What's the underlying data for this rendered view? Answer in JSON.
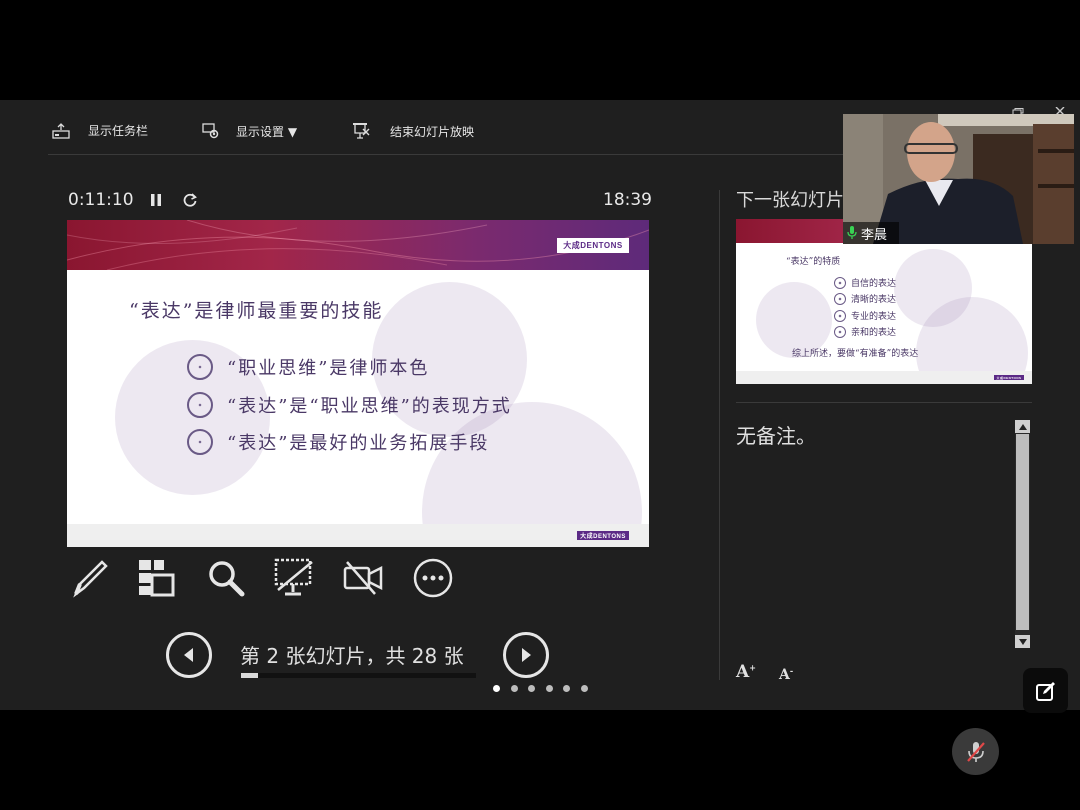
{
  "toolbar": {
    "show_taskbar": "显示任务栏",
    "display_settings": "显示设置 ▼",
    "end_slideshow": "结束幻灯片放映"
  },
  "status": {
    "elapsed_time": "0:11:10",
    "clock": "18:39"
  },
  "current_slide": {
    "logo": "大成DENTONS",
    "title": "“表达”是律师最重要的技能",
    "bullets": [
      "“职业思维”是律师本色",
      "“表达”是“职业思维”的表现方式",
      "“表达”是最好的业务拓展手段"
    ],
    "footer_logo": "大成DENTONS"
  },
  "navigation": {
    "slide_counter": "第 2 张幻灯片，共 28 张",
    "current": 2,
    "total": 28
  },
  "next_slide": {
    "label": "下一张幻灯片",
    "title": "“表达”的特质",
    "bullets": [
      "自信的表达",
      "清晰的表达",
      "专业的表达",
      "亲和的表达"
    ],
    "summary": "综上所述，要做“有准备”的表达",
    "footer_logo": "大成DENTONS"
  },
  "notes": {
    "text": "无备注。"
  },
  "video": {
    "participant_name": "李晨"
  },
  "colors": {
    "window_bg": "#1f1f1f",
    "slide_text": "#4a3866",
    "brand_purple": "#5b2a86",
    "banner_red": "#a22649"
  },
  "icons": [
    "taskbar-icon",
    "display-settings-icon",
    "end-slideshow-icon",
    "pen-icon",
    "slides-grid-icon",
    "zoom-icon",
    "black-screen-icon",
    "camera-off-icon",
    "more-options-icon",
    "prev-arrow-icon",
    "next-arrow-icon",
    "increase-font-icon",
    "decrease-font-icon",
    "mic-icon",
    "edit-icon",
    "mic-muted-icon"
  ]
}
